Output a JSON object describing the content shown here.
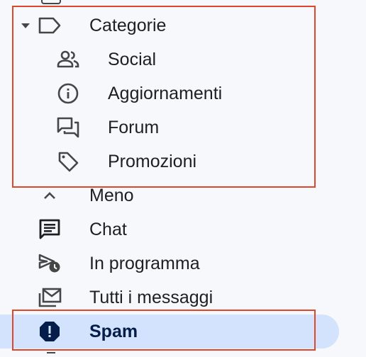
{
  "sidebar": {
    "categories": {
      "label": "Categorie",
      "expanded": true,
      "items": [
        {
          "label": "Social",
          "icon": "people-icon"
        },
        {
          "label": "Aggiornamenti",
          "icon": "info-icon"
        },
        {
          "label": "Forum",
          "icon": "forum-icon"
        },
        {
          "label": "Promozioni",
          "icon": "tag-icon"
        }
      ]
    },
    "items": [
      {
        "label": "Meno",
        "icon": "chevron-up-icon"
      },
      {
        "label": "Chat",
        "icon": "chat-icon"
      },
      {
        "label": "In programma",
        "icon": "scheduled-send-icon"
      },
      {
        "label": "Tutti i messaggi",
        "icon": "all-mail-icon"
      },
      {
        "label": "Spam",
        "icon": "spam-icon",
        "selected": true
      }
    ]
  },
  "colors": {
    "background": "#f6f8fc",
    "selected_background": "#d3e3fd",
    "selected_text": "#041e49",
    "icon": "#444746",
    "highlight_border": "#e0462c"
  }
}
